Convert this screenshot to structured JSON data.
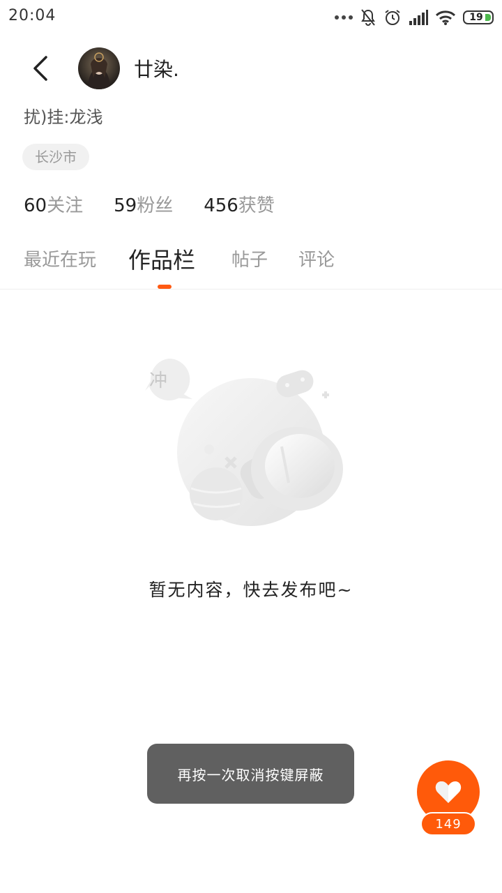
{
  "status_bar": {
    "time": "20:04",
    "battery": "19",
    "icons": [
      "more-dots-icon",
      "bell-muted-icon",
      "alarm-icon",
      "signal-icon",
      "wifi-icon",
      "battery-icon"
    ]
  },
  "profile": {
    "name": "廿染.",
    "bio": "扰)挂:龙浅",
    "location": "长沙市",
    "stats": [
      {
        "num": "60",
        "label": "关注"
      },
      {
        "num": "59",
        "label": "粉丝"
      },
      {
        "num": "456",
        "label": "获赞"
      }
    ]
  },
  "tabs": [
    {
      "label": "最近在玩",
      "active": false
    },
    {
      "label": "作品栏",
      "active": true
    },
    {
      "label": "帖子",
      "active": false
    },
    {
      "label": "评论",
      "active": false
    }
  ],
  "empty_state": {
    "badge": "冲",
    "text": "暂无内容，快去发布吧~"
  },
  "toast": "再按一次取消按键屏蔽",
  "like": {
    "count": "149"
  },
  "colors": {
    "accent": "#ff5a0a",
    "toast_bg": "#606060",
    "muted_text": "#999999"
  }
}
